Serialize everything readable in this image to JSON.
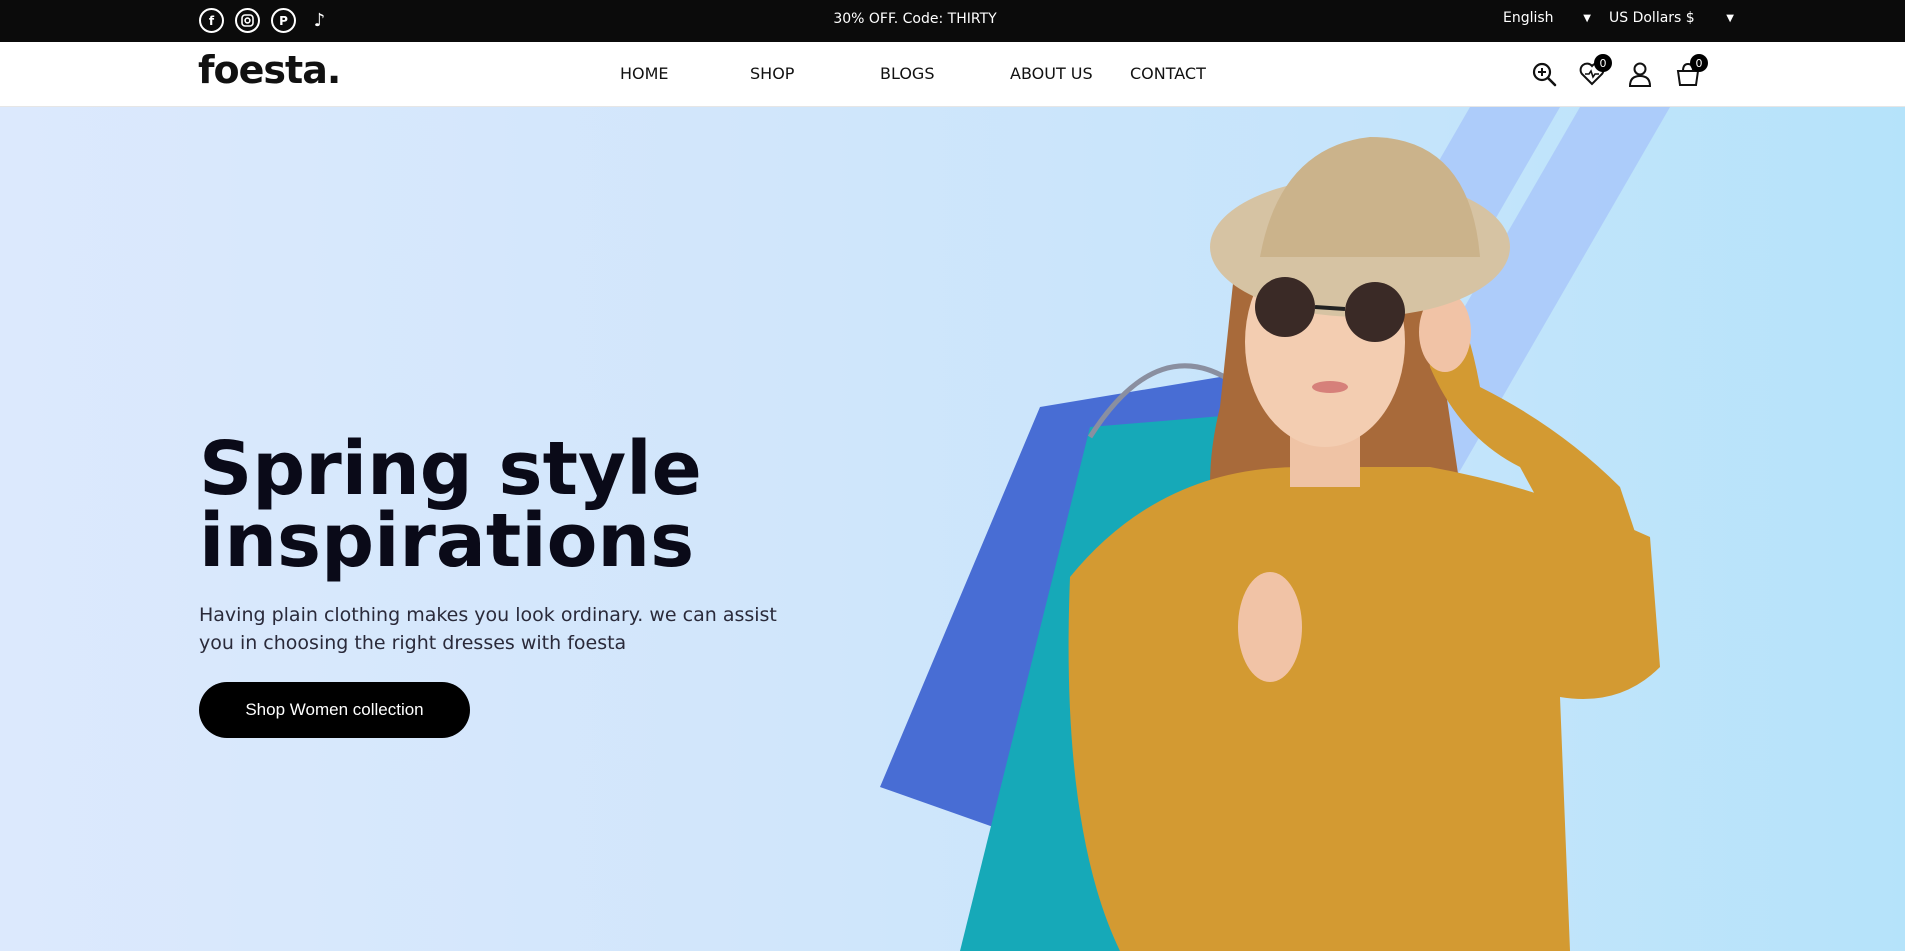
{
  "topbar": {
    "socials": [
      {
        "name": "facebook-icon",
        "glyph": "f"
      },
      {
        "name": "instagram-icon",
        "glyph": "◘"
      },
      {
        "name": "pinterest-icon",
        "glyph": "P"
      },
      {
        "name": "tiktok-icon",
        "glyph": "♪"
      }
    ],
    "promo": "30% OFF. Code: THIRTY",
    "language": "English",
    "currency": "US Dollars $"
  },
  "header": {
    "logo": "foesta.",
    "nav": [
      "HOME",
      "SHOP",
      "BLOGS",
      "ABOUT US",
      "CONTACT"
    ],
    "wishlist_count": "0",
    "cart_count": "0"
  },
  "hero": {
    "title_line1": "Spring style",
    "title_line2": "inspirations",
    "subtitle": "Having plain clothing makes you look ordinary. we can assist you in choosing the right dresses with foesta",
    "cta": "Shop Women collection"
  },
  "colors": {
    "topbar_bg": "#0b0b0b",
    "hero_bg_start": "#dce9fd",
    "hero_bg_end": "#b5e3fa",
    "cta_bg": "#000000",
    "sweater": "#d39a32",
    "bag_teal": "#16a9b8",
    "bag_blue": "#3a5fcf"
  }
}
